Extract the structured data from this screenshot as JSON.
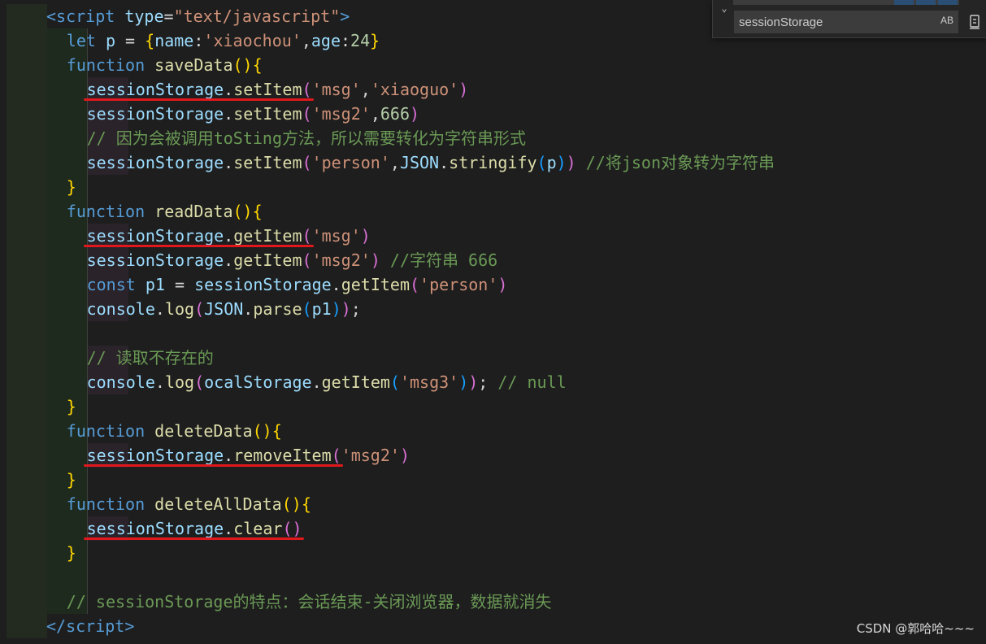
{
  "colors": {
    "keyword": "#569cd6",
    "function_name": "#dcdcaa",
    "variable": "#9cdcfe",
    "string": "#ce9178",
    "number": "#b5cea8",
    "comment": "#6a9955",
    "bracket_gold": "#ffd700",
    "bracket_pink": "#da70d6",
    "bracket_blue": "#179fff",
    "tag": "#569cd6",
    "attr": "#9cdcfe",
    "plain": "#d4d4d4",
    "underline": "#e0181d"
  },
  "find_widget": {
    "query": "sessionStorage",
    "match_case_label": "AB",
    "toggle_icon": "chevron-down-icon",
    "action_icon": "replace-all-icon"
  },
  "watermark": "CSDN @郭哈哈~~~",
  "code_lines": [
    {
      "indent": 0,
      "tokens": [
        [
          "<",
          "tag"
        ],
        [
          "script",
          "tag"
        ],
        [
          " ",
          "plain"
        ],
        [
          "type",
          "attr"
        ],
        [
          "=",
          "plain"
        ],
        [
          "\"text/javascript\"",
          "string"
        ],
        [
          ">",
          "tag"
        ]
      ]
    },
    {
      "indent": 2,
      "tokens": [
        [
          "let",
          "keyword"
        ],
        [
          " ",
          "plain"
        ],
        [
          "p",
          "variable"
        ],
        [
          " = ",
          "plain"
        ],
        [
          "{",
          "bracket_gold"
        ],
        [
          "name",
          "variable"
        ],
        [
          ":",
          "plain"
        ],
        [
          "'xiaochou'",
          "string"
        ],
        [
          ",",
          "plain"
        ],
        [
          "age",
          "variable"
        ],
        [
          ":",
          "plain"
        ],
        [
          "24",
          "number"
        ],
        [
          "}",
          "bracket_gold"
        ]
      ]
    },
    {
      "indent": 2,
      "tokens": [
        [
          "function",
          "keyword"
        ],
        [
          " ",
          "plain"
        ],
        [
          "saveData",
          "function_name"
        ],
        [
          "()",
          "bracket_gold"
        ],
        [
          "{",
          "bracket_gold"
        ]
      ]
    },
    {
      "indent": 4,
      "tokens": [
        [
          "sessionStorage",
          "variable"
        ],
        [
          ".",
          "plain"
        ],
        [
          "setItem",
          "function_name"
        ],
        [
          "(",
          "bracket_pink"
        ],
        [
          "'msg'",
          "string"
        ],
        [
          ",",
          "plain"
        ],
        [
          "'xiaoguo'",
          "string"
        ],
        [
          ")",
          "bracket_pink"
        ]
      ]
    },
    {
      "indent": 4,
      "tokens": [
        [
          "sessionStorage",
          "variable"
        ],
        [
          ".",
          "plain"
        ],
        [
          "setItem",
          "function_name"
        ],
        [
          "(",
          "bracket_pink"
        ],
        [
          "'msg2'",
          "string"
        ],
        [
          ",",
          "plain"
        ],
        [
          "666",
          "number"
        ],
        [
          ")",
          "bracket_pink"
        ]
      ]
    },
    {
      "indent": 4,
      "tokens": [
        [
          "// 因为会被调用toSting方法，所以需要转化为字符串形式",
          "comment"
        ]
      ]
    },
    {
      "indent": 4,
      "tokens": [
        [
          "sessionStorage",
          "variable"
        ],
        [
          ".",
          "plain"
        ],
        [
          "setItem",
          "function_name"
        ],
        [
          "(",
          "bracket_pink"
        ],
        [
          "'person'",
          "string"
        ],
        [
          ",",
          "plain"
        ],
        [
          "JSON",
          "variable"
        ],
        [
          ".",
          "plain"
        ],
        [
          "stringify",
          "function_name"
        ],
        [
          "(",
          "bracket_blue"
        ],
        [
          "p",
          "variable"
        ],
        [
          ")",
          "bracket_blue"
        ],
        [
          ")",
          "bracket_pink"
        ],
        [
          " ",
          "plain"
        ],
        [
          "//将json对象转为字符串",
          "comment"
        ]
      ]
    },
    {
      "indent": 2,
      "tokens": [
        [
          "}",
          "bracket_gold"
        ]
      ]
    },
    {
      "indent": 2,
      "tokens": [
        [
          "function",
          "keyword"
        ],
        [
          " ",
          "plain"
        ],
        [
          "readData",
          "function_name"
        ],
        [
          "()",
          "bracket_gold"
        ],
        [
          "{",
          "bracket_gold"
        ]
      ]
    },
    {
      "indent": 4,
      "tokens": [
        [
          "sessionStorage",
          "variable"
        ],
        [
          ".",
          "plain"
        ],
        [
          "getItem",
          "function_name"
        ],
        [
          "(",
          "bracket_pink"
        ],
        [
          "'msg'",
          "string"
        ],
        [
          ")",
          "bracket_pink"
        ]
      ]
    },
    {
      "indent": 4,
      "tokens": [
        [
          "sessionStorage",
          "variable"
        ],
        [
          ".",
          "plain"
        ],
        [
          "getItem",
          "function_name"
        ],
        [
          "(",
          "bracket_pink"
        ],
        [
          "'msg2'",
          "string"
        ],
        [
          ")",
          "bracket_pink"
        ],
        [
          " ",
          "plain"
        ],
        [
          "//字符串 666",
          "comment"
        ]
      ]
    },
    {
      "indent": 4,
      "tokens": [
        [
          "const",
          "keyword"
        ],
        [
          " ",
          "plain"
        ],
        [
          "p1",
          "variable"
        ],
        [
          " = ",
          "plain"
        ],
        [
          "sessionStorage",
          "variable"
        ],
        [
          ".",
          "plain"
        ],
        [
          "getItem",
          "function_name"
        ],
        [
          "(",
          "bracket_pink"
        ],
        [
          "'person'",
          "string"
        ],
        [
          ")",
          "bracket_pink"
        ]
      ]
    },
    {
      "indent": 4,
      "tokens": [
        [
          "console",
          "variable"
        ],
        [
          ".",
          "plain"
        ],
        [
          "log",
          "function_name"
        ],
        [
          "(",
          "bracket_pink"
        ],
        [
          "JSON",
          "variable"
        ],
        [
          ".",
          "plain"
        ],
        [
          "parse",
          "function_name"
        ],
        [
          "(",
          "bracket_blue"
        ],
        [
          "p1",
          "variable"
        ],
        [
          ")",
          "bracket_blue"
        ],
        [
          ")",
          "bracket_pink"
        ],
        [
          ";",
          "plain"
        ]
      ]
    },
    {
      "indent": -1,
      "tokens": []
    },
    {
      "indent": 4,
      "tokens": [
        [
          "// 读取不存在的",
          "comment"
        ]
      ]
    },
    {
      "indent": 4,
      "tokens": [
        [
          "console",
          "variable"
        ],
        [
          ".",
          "plain"
        ],
        [
          "log",
          "function_name"
        ],
        [
          "(",
          "bracket_pink"
        ],
        [
          "ocalStorage",
          "variable"
        ],
        [
          ".",
          "plain"
        ],
        [
          "getItem",
          "function_name"
        ],
        [
          "(",
          "bracket_blue"
        ],
        [
          "'msg3'",
          "string"
        ],
        [
          ")",
          "bracket_blue"
        ],
        [
          ")",
          "bracket_pink"
        ],
        [
          ";",
          "plain"
        ],
        [
          " ",
          "plain"
        ],
        [
          "// null",
          "comment"
        ]
      ]
    },
    {
      "indent": 2,
      "tokens": [
        [
          "}",
          "bracket_gold"
        ]
      ]
    },
    {
      "indent": 2,
      "tokens": [
        [
          "function",
          "keyword"
        ],
        [
          " ",
          "plain"
        ],
        [
          "deleteData",
          "function_name"
        ],
        [
          "()",
          "bracket_gold"
        ],
        [
          "{",
          "bracket_gold"
        ]
      ]
    },
    {
      "indent": 4,
      "tokens": [
        [
          "sessionStorage",
          "variable"
        ],
        [
          ".",
          "plain"
        ],
        [
          "removeItem",
          "function_name"
        ],
        [
          "(",
          "bracket_pink"
        ],
        [
          "'msg2'",
          "string"
        ],
        [
          ")",
          "bracket_pink"
        ]
      ]
    },
    {
      "indent": 2,
      "tokens": [
        [
          "}",
          "bracket_gold"
        ]
      ]
    },
    {
      "indent": 2,
      "tokens": [
        [
          "function",
          "keyword"
        ],
        [
          " ",
          "plain"
        ],
        [
          "deleteAllData",
          "function_name"
        ],
        [
          "()",
          "bracket_gold"
        ],
        [
          "{",
          "bracket_gold"
        ]
      ]
    },
    {
      "indent": 4,
      "tokens": [
        [
          "sessionStorage",
          "variable"
        ],
        [
          ".",
          "plain"
        ],
        [
          "clear",
          "function_name"
        ],
        [
          "()",
          "bracket_pink"
        ]
      ]
    },
    {
      "indent": 2,
      "tokens": [
        [
          "}",
          "bracket_gold"
        ]
      ]
    },
    {
      "indent": -1,
      "tokens": []
    },
    {
      "indent": 2,
      "tokens": [
        [
          "// sessionStorage的特点：会话结束-关闭浏览器，数据就消失",
          "comment"
        ]
      ]
    },
    {
      "indent": 0,
      "tokens": [
        [
          "</",
          "tag"
        ],
        [
          "script",
          "tag"
        ],
        [
          ">",
          "tag"
        ]
      ]
    }
  ],
  "underlined_lines": [
    3,
    9,
    18,
    21
  ]
}
